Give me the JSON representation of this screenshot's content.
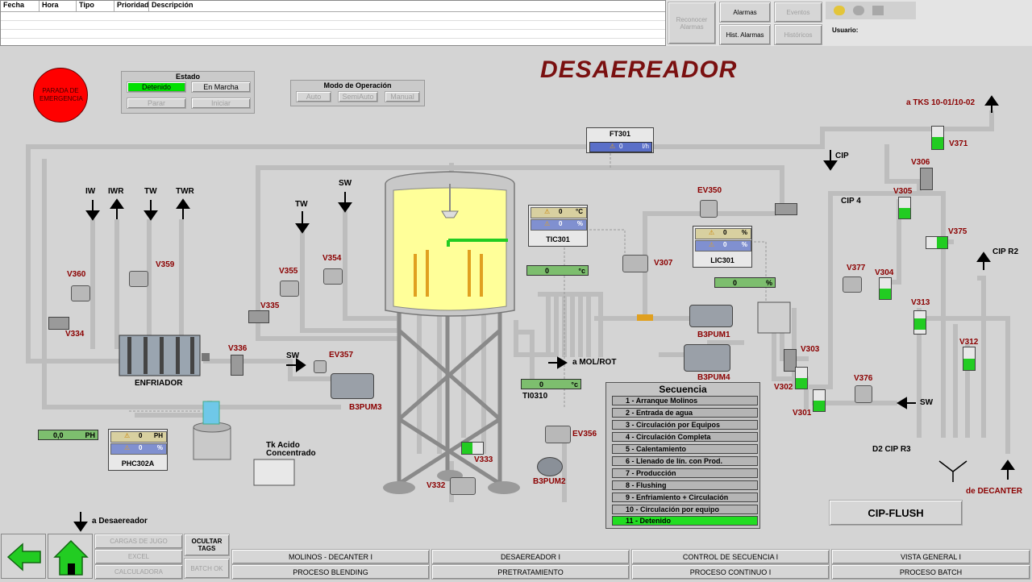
{
  "alarm_table": {
    "headers": [
      "Fecha",
      "Hora",
      "Tipo",
      "Prioridad",
      "Descripción"
    ]
  },
  "alarm_buttons": {
    "reconocer": "Reconocer Alarmas",
    "alarmas": "Alarmas",
    "eventos": "Eventos",
    "hist_alarmas": "Hist. Alarmas",
    "historicos": "Históricos",
    "usuario": "Usuario:"
  },
  "title": "DESAEREADOR",
  "emergency": "PARADA DE EMERGENCIA",
  "estado": {
    "title": "Estado",
    "detenido": "Detenido",
    "en_marcha": "En Marcha",
    "parar": "Parar",
    "iniciar": "Iniciar"
  },
  "modo": {
    "title": "Modo de Operación",
    "auto": "Auto",
    "semiauto": "SemiAuto",
    "manual": "Manual"
  },
  "ft301": {
    "name": "FT301",
    "value": "0",
    "unit": "l/h"
  },
  "tic301": {
    "name": "TIC301",
    "sp": "0",
    "sp_unit": "°C",
    "pv": "0",
    "pv_unit": "%"
  },
  "lic301": {
    "name": "LIC301",
    "sp": "0",
    "sp_unit": "%",
    "pv": "0",
    "pv_unit": "%"
  },
  "phc302": {
    "name": "PHC302A",
    "sp": "0",
    "sp_unit": "PH",
    "pv": "0",
    "pv_unit": "%"
  },
  "bars": {
    "temp": {
      "value": "0",
      "unit": "°c"
    },
    "level": {
      "value": "0",
      "unit": "%"
    },
    "ti0310": {
      "value": "0",
      "unit": "°c"
    },
    "ph": {
      "value": "0,0",
      "unit": "PH"
    }
  },
  "labels": {
    "iw": "IW",
    "iwr": "IWR",
    "tw": "TW",
    "twr": "TWR",
    "tw2": "TW",
    "sw1": "SW",
    "sw2": "SW",
    "sw3": "SW",
    "enfriador": "ENFRIADOR",
    "ti0310": "TI0310",
    "a_mol": "a MOL/ROT",
    "tk_acido": "Tk Acido",
    "concentrado": "Concentrado",
    "a_desaereador": "a Desaereador",
    "a_tks": "a TKS 10-01/10-02",
    "cip": "CIP",
    "cip4": "CIP 4",
    "cip_r2": "CIP R2",
    "d2_cip_r3": "D2 CIP R3",
    "de_decanter": "de DECANTER"
  },
  "valves": {
    "v360": "V360",
    "v359": "V359",
    "v334": "V334",
    "v335": "V335",
    "v336": "V336",
    "v355": "V355",
    "v354": "V354",
    "ev357": "EV357",
    "v307": "V307",
    "ev350": "EV350",
    "v371": "V371",
    "v306": "V306",
    "v305": "V305",
    "v375": "V375",
    "v377": "V377",
    "v304": "V304",
    "v313": "V313",
    "v312": "V312",
    "v303": "V303",
    "v302": "V302",
    "v301": "V301",
    "v376": "V376",
    "ev356": "EV356",
    "v333": "V333",
    "v332": "V332"
  },
  "pumps": {
    "b3pum1": "B3PUM1",
    "b3pum4": "B3PUM4",
    "b3pum3": "B3PUM3",
    "b3pum2": "B3PUM2"
  },
  "secuencia": {
    "title": "Secuencia",
    "items": [
      "1 - Arranque Molinos",
      "2 - Entrada de agua",
      "3 - Circulación por Equipos",
      "4 - Circulación Completa",
      "5 - Calentamiento",
      "6 - Llenado de lín. con Prod.",
      "7 - Producción",
      "8 - Flushing",
      "9 - Enfriamiento + Circulación",
      "10 - Circulación por equipo",
      "11 - Detenido"
    ],
    "active_index": 10
  },
  "cip_flush": "CIP-FLUSH",
  "bottom": {
    "cargas": "CARGAS DE JUGO",
    "excel": "EXCEL",
    "calculadora": "CALCULADORA",
    "ocultar": "OCULTAR TAGS",
    "batch_ok": "BATCH OK",
    "tabs": [
      "MOLINOS - DECANTER I",
      "DESAEREADOR I",
      "CONTROL DE SECUENCIA I",
      "VISTA GENERAL I",
      "PROCESO BLENDING",
      "PRETRATAMIENTO",
      "PROCESO CONTINUO I",
      "PROCESO BATCH"
    ]
  },
  "colors": {
    "title": "#7a1010",
    "green_active": "#00e000",
    "bar_green": "#7dbe6e",
    "blue_value": "#5a6fc8",
    "tank_fill": "#ffff99",
    "emergency": "#ff0000"
  }
}
